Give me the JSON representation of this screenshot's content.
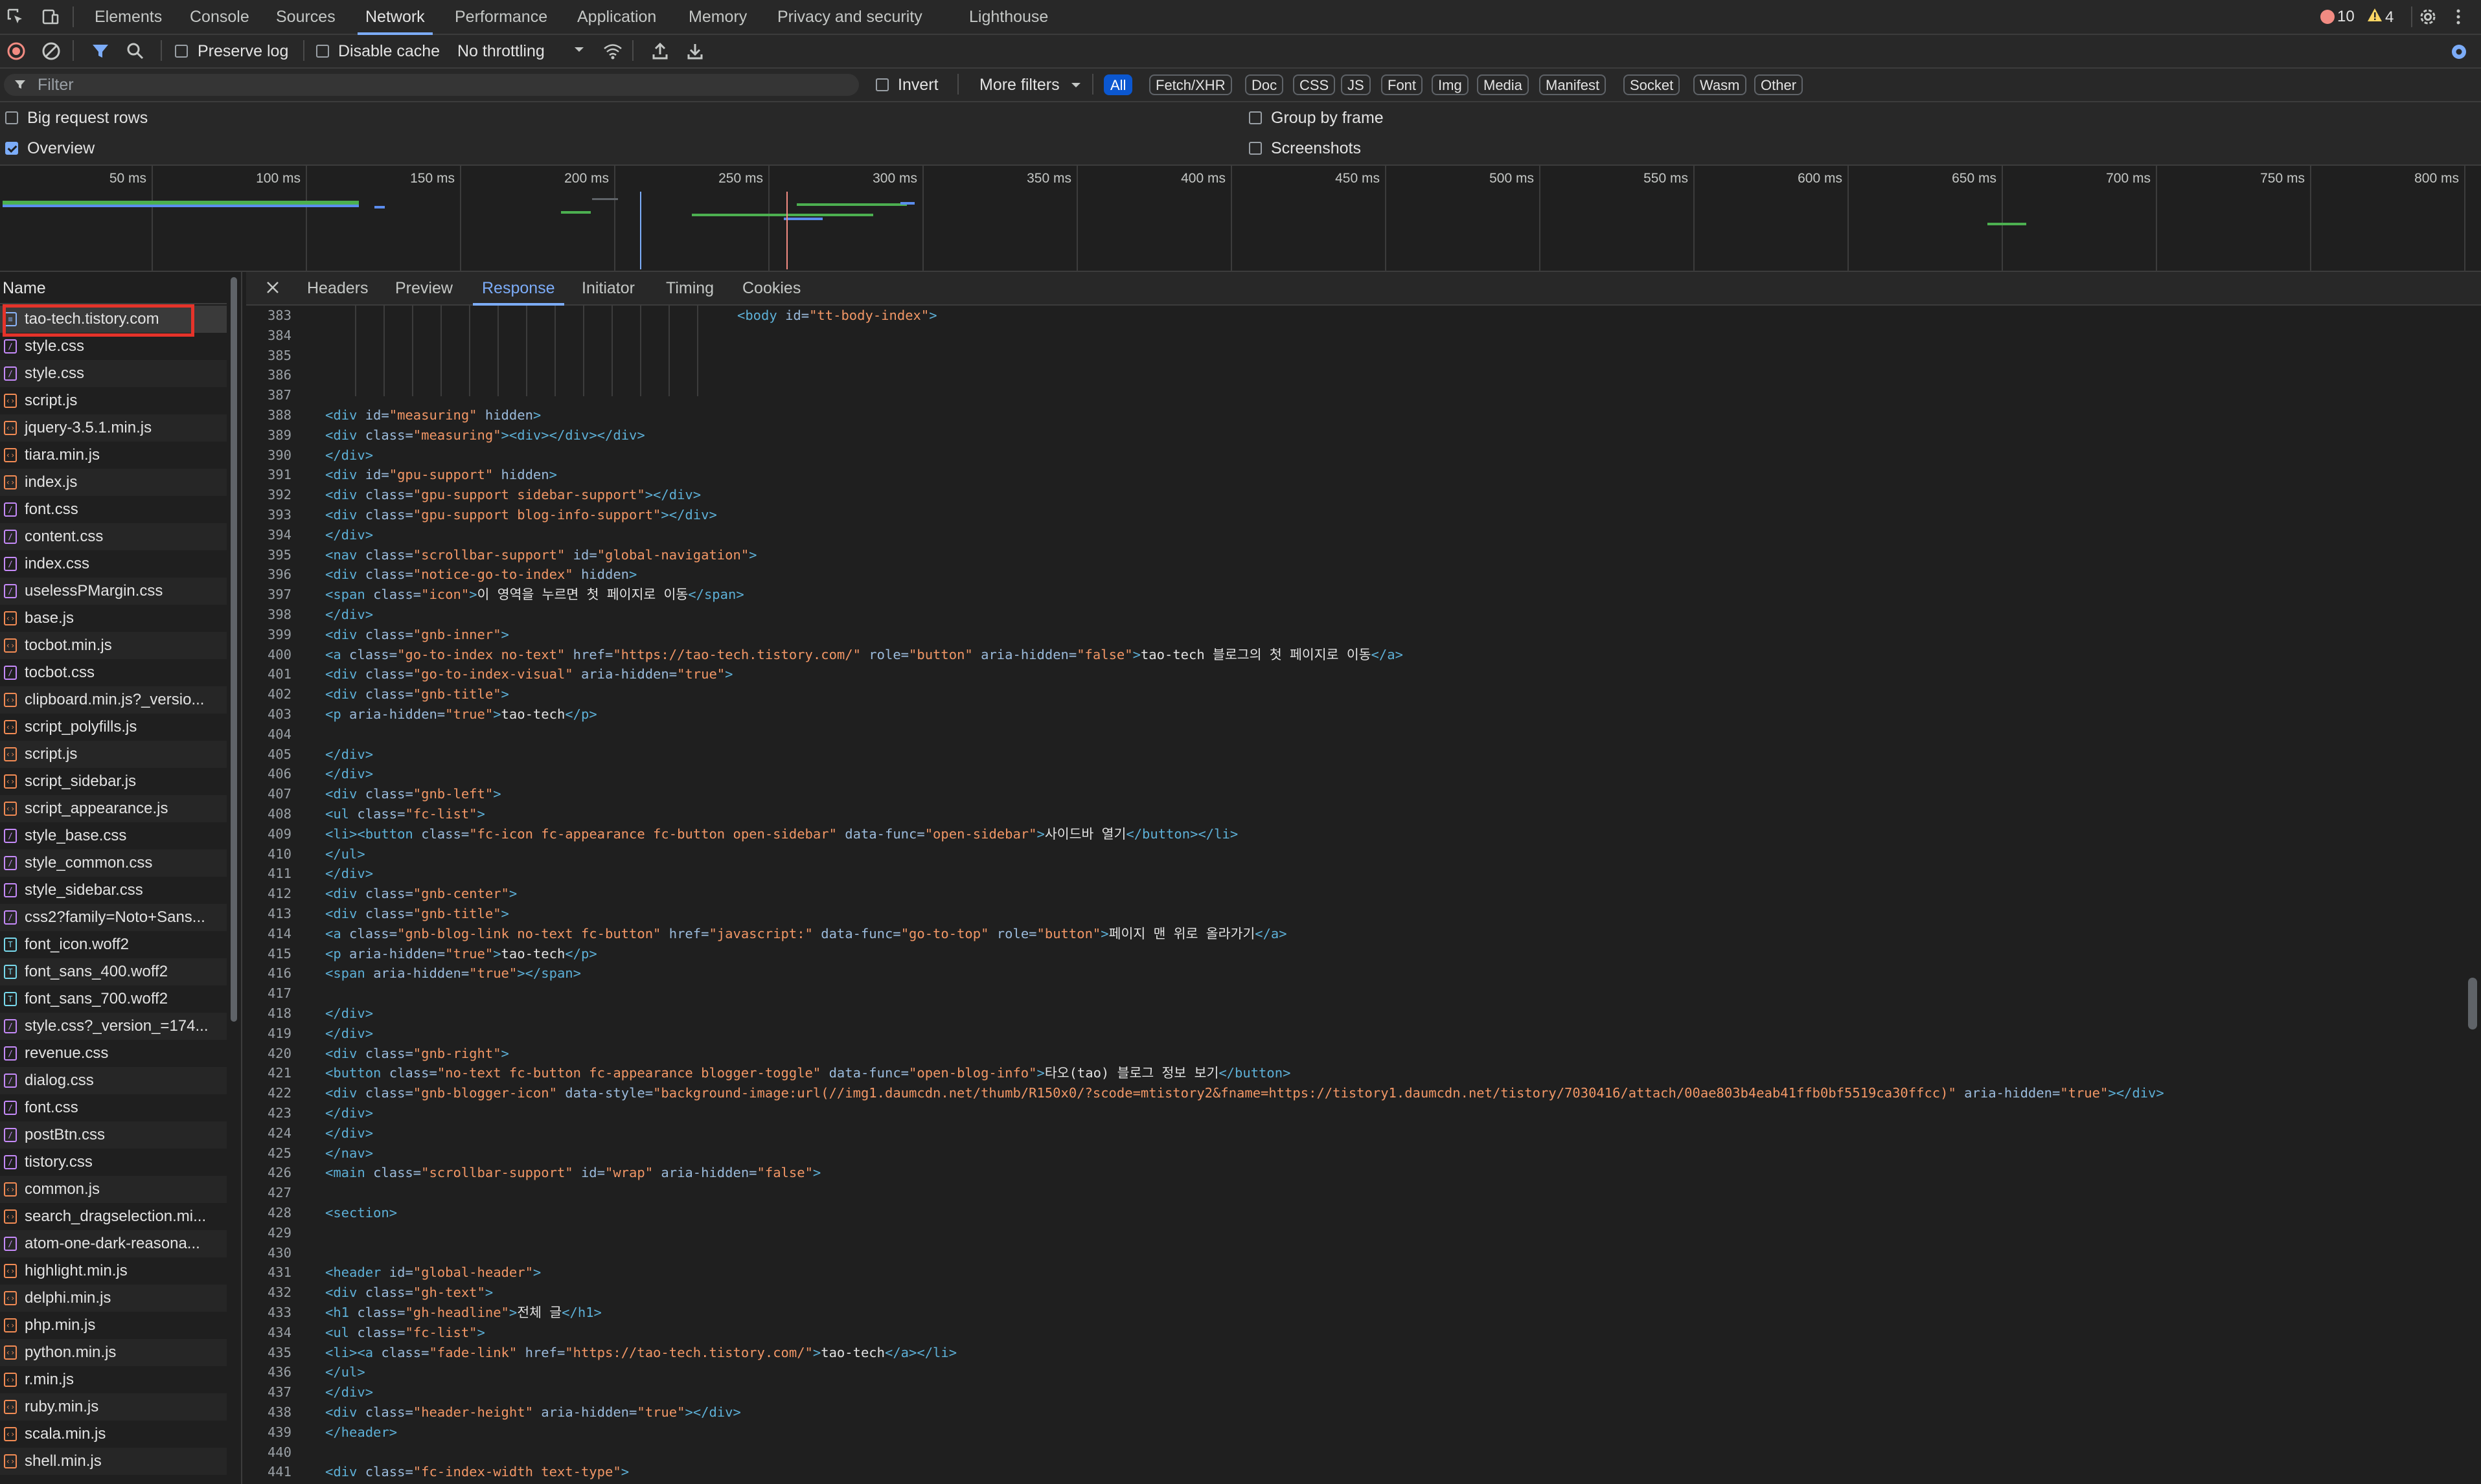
{
  "tabs": {
    "items": [
      "Elements",
      "Console",
      "Sources",
      "Network",
      "Performance",
      "Application",
      "Memory",
      "Privacy and security",
      "Lighthouse"
    ],
    "active": "Network"
  },
  "status": {
    "errors": "10",
    "warnings": "4"
  },
  "toolbar": {
    "preserve_log": "Preserve log",
    "disable_cache": "Disable cache",
    "throttling": "No throttling"
  },
  "filter": {
    "placeholder": "Filter",
    "invert": "Invert",
    "more_filters": "More filters",
    "chips": [
      "All",
      "Fetch/XHR",
      "Doc",
      "CSS",
      "JS",
      "Font",
      "Img",
      "Media",
      "Manifest",
      "Socket",
      "Wasm",
      "Other"
    ],
    "active_chip": "All"
  },
  "options": {
    "big_rows": "Big request rows",
    "overview": "Overview",
    "group_by_frame": "Group by frame",
    "screenshots": "Screenshots",
    "big_rows_checked": false,
    "overview_checked": true
  },
  "overview": {
    "ticks": [
      "50 ms",
      "100 ms",
      "150 ms",
      "200 ms",
      "250 ms",
      "300 ms",
      "350 ms",
      "400 ms",
      "450 ms",
      "500 ms",
      "550 ms",
      "600 ms",
      "650 ms",
      "700 ms",
      "750 ms",
      "800 ms"
    ]
  },
  "requests": {
    "header": "Name",
    "selected": "tao-tech.tistory.com",
    "items": [
      {
        "name": "tao-tech.tistory.com",
        "type": "doc"
      },
      {
        "name": "style.css",
        "type": "css"
      },
      {
        "name": "style.css",
        "type": "css"
      },
      {
        "name": "script.js",
        "type": "js"
      },
      {
        "name": "jquery-3.5.1.min.js",
        "type": "js"
      },
      {
        "name": "tiara.min.js",
        "type": "js"
      },
      {
        "name": "index.js",
        "type": "js"
      },
      {
        "name": "font.css",
        "type": "css"
      },
      {
        "name": "content.css",
        "type": "css"
      },
      {
        "name": "index.css",
        "type": "css"
      },
      {
        "name": "uselessPMargin.css",
        "type": "css"
      },
      {
        "name": "base.js",
        "type": "js"
      },
      {
        "name": "tocbot.min.js",
        "type": "js"
      },
      {
        "name": "tocbot.css",
        "type": "css"
      },
      {
        "name": "clipboard.min.js?_versio...",
        "type": "js"
      },
      {
        "name": "script_polyfills.js",
        "type": "js"
      },
      {
        "name": "script.js",
        "type": "js"
      },
      {
        "name": "script_sidebar.js",
        "type": "js"
      },
      {
        "name": "script_appearance.js",
        "type": "js"
      },
      {
        "name": "style_base.css",
        "type": "css"
      },
      {
        "name": "style_common.css",
        "type": "css"
      },
      {
        "name": "style_sidebar.css",
        "type": "css"
      },
      {
        "name": "css2?family=Noto+Sans...",
        "type": "css"
      },
      {
        "name": "font_icon.woff2",
        "type": "font"
      },
      {
        "name": "font_sans_400.woff2",
        "type": "font"
      },
      {
        "name": "font_sans_700.woff2",
        "type": "font"
      },
      {
        "name": "style.css?_version_=174...",
        "type": "css"
      },
      {
        "name": "revenue.css",
        "type": "css"
      },
      {
        "name": "dialog.css",
        "type": "css"
      },
      {
        "name": "font.css",
        "type": "css"
      },
      {
        "name": "postBtn.css",
        "type": "css"
      },
      {
        "name": "tistory.css",
        "type": "css"
      },
      {
        "name": "common.js",
        "type": "js"
      },
      {
        "name": "search_dragselection.mi...",
        "type": "js"
      },
      {
        "name": "atom-one-dark-reasona...",
        "type": "css"
      },
      {
        "name": "highlight.min.js",
        "type": "js"
      },
      {
        "name": "delphi.min.js",
        "type": "js"
      },
      {
        "name": "php.min.js",
        "type": "js"
      },
      {
        "name": "python.min.js",
        "type": "js"
      },
      {
        "name": "r.min.js",
        "type": "js"
      },
      {
        "name": "ruby.min.js",
        "type": "js"
      },
      {
        "name": "scala.min.js",
        "type": "js"
      },
      {
        "name": "shell.min.js",
        "type": "js"
      }
    ]
  },
  "detail": {
    "tabs": [
      "Headers",
      "Preview",
      "Response",
      "Initiator",
      "Timing",
      "Cookies"
    ],
    "active_tab": "Response"
  },
  "code_lines": [
    {
      "n": "383",
      "t": "<body id=\"tt-body-index\">",
      "indent": 1
    },
    {
      "n": "384",
      "t": ""
    },
    {
      "n": "385",
      "t": ""
    },
    {
      "n": "386",
      "t": ""
    },
    {
      "n": "387",
      "t": ""
    },
    {
      "n": "388",
      "t": "<div id=\"measuring\" hidden>"
    },
    {
      "n": "389",
      "t": "<div class=\"measuring\"><div></div></div>"
    },
    {
      "n": "390",
      "t": "</div>"
    },
    {
      "n": "391",
      "t": "<div id=\"gpu-support\" hidden>"
    },
    {
      "n": "392",
      "t": "<div class=\"gpu-support sidebar-support\"></div>"
    },
    {
      "n": "393",
      "t": "<div class=\"gpu-support blog-info-support\"></div>"
    },
    {
      "n": "394",
      "t": "</div>"
    },
    {
      "n": "395",
      "t": "<nav class=\"scrollbar-support\" id=\"global-navigation\">"
    },
    {
      "n": "396",
      "t": "<div class=\"notice-go-to-index\" hidden>"
    },
    {
      "n": "397",
      "t": "<span class=\"icon\">이 영역을 누르면 첫 페이지로 이동</span>"
    },
    {
      "n": "398",
      "t": "</div>"
    },
    {
      "n": "399",
      "t": "<div class=\"gnb-inner\">"
    },
    {
      "n": "400",
      "t": "<a class=\"go-to-index no-text\" href=\"https://tao-tech.tistory.com/\" role=\"button\" aria-hidden=\"false\">tao-tech 블로그의 첫 페이지로 이동</a>"
    },
    {
      "n": "401",
      "t": "<div class=\"go-to-index-visual\" aria-hidden=\"true\">"
    },
    {
      "n": "402",
      "t": "<div class=\"gnb-title\">"
    },
    {
      "n": "403",
      "t": "<p aria-hidden=\"true\">tao-tech</p>"
    },
    {
      "n": "404",
      "t": ""
    },
    {
      "n": "405",
      "t": "</div>"
    },
    {
      "n": "406",
      "t": "</div>"
    },
    {
      "n": "407",
      "t": "<div class=\"gnb-left\">"
    },
    {
      "n": "408",
      "t": "<ul class=\"fc-list\">"
    },
    {
      "n": "409",
      "t": "<li><button class=\"fc-icon fc-appearance fc-button open-sidebar\" data-func=\"open-sidebar\">사이드바 열기</button></li>"
    },
    {
      "n": "410",
      "t": "</ul>"
    },
    {
      "n": "411",
      "t": "</div>"
    },
    {
      "n": "412",
      "t": "<div class=\"gnb-center\">"
    },
    {
      "n": "413",
      "t": "<div class=\"gnb-title\">"
    },
    {
      "n": "414",
      "t": "<a class=\"gnb-blog-link no-text fc-button\" href=\"javascript:\" data-func=\"go-to-top\" role=\"button\">페이지 맨 위로 올라가기</a>"
    },
    {
      "n": "415",
      "t": "<p aria-hidden=\"true\">tao-tech</p>"
    },
    {
      "n": "416",
      "t": "<span aria-hidden=\"true\"></span>"
    },
    {
      "n": "417",
      "t": ""
    },
    {
      "n": "418",
      "t": "</div>"
    },
    {
      "n": "419",
      "t": "</div>"
    },
    {
      "n": "420",
      "t": "<div class=\"gnb-right\">"
    },
    {
      "n": "421",
      "t": "<button class=\"no-text fc-button fc-appearance blogger-toggle\" data-func=\"open-blog-info\">타오(tao) 블로그 정보 보기</button>"
    },
    {
      "n": "422",
      "t": "<div class=\"gnb-blogger-icon\" data-style=\"background-image:url(//img1.daumcdn.net/thumb/R150x0/?scode=mtistory2&fname=https://tistory1.daumcdn.net/tistory/7030416/attach/00ae803b4eab41ffb0bf5519ca30ffcc)\" aria-hidden=\"true\"></div>"
    },
    {
      "n": "423",
      "t": "</div>"
    },
    {
      "n": "424",
      "t": "</div>"
    },
    {
      "n": "425",
      "t": "</nav>"
    },
    {
      "n": "426",
      "t": "<main class=\"scrollbar-support\" id=\"wrap\" aria-hidden=\"false\">"
    },
    {
      "n": "427",
      "t": ""
    },
    {
      "n": "428",
      "t": "<section>"
    },
    {
      "n": "429",
      "t": ""
    },
    {
      "n": "430",
      "t": ""
    },
    {
      "n": "431",
      "t": "<header id=\"global-header\">"
    },
    {
      "n": "432",
      "t": "<div class=\"gh-text\">"
    },
    {
      "n": "433",
      "t": "<h1 class=\"gh-headline\">전체 글</h1>"
    },
    {
      "n": "434",
      "t": "<ul class=\"fc-list\">"
    },
    {
      "n": "435",
      "t": "<li><a class=\"fade-link\" href=\"https://tao-tech.tistory.com/\">tao-tech</a></li>"
    },
    {
      "n": "436",
      "t": "</ul>"
    },
    {
      "n": "437",
      "t": "</div>"
    },
    {
      "n": "438",
      "t": "<div class=\"header-height\" aria-hidden=\"true\"></div>"
    },
    {
      "n": "439",
      "t": "</header>"
    },
    {
      "n": "440",
      "t": ""
    },
    {
      "n": "441",
      "t": "<div class=\"fc-index-width text-type\">"
    }
  ],
  "colors": {
    "accent": "#7cacf8",
    "error": "#f28b82",
    "warning": "#fdd663",
    "highlight_box": "#e5332a"
  }
}
